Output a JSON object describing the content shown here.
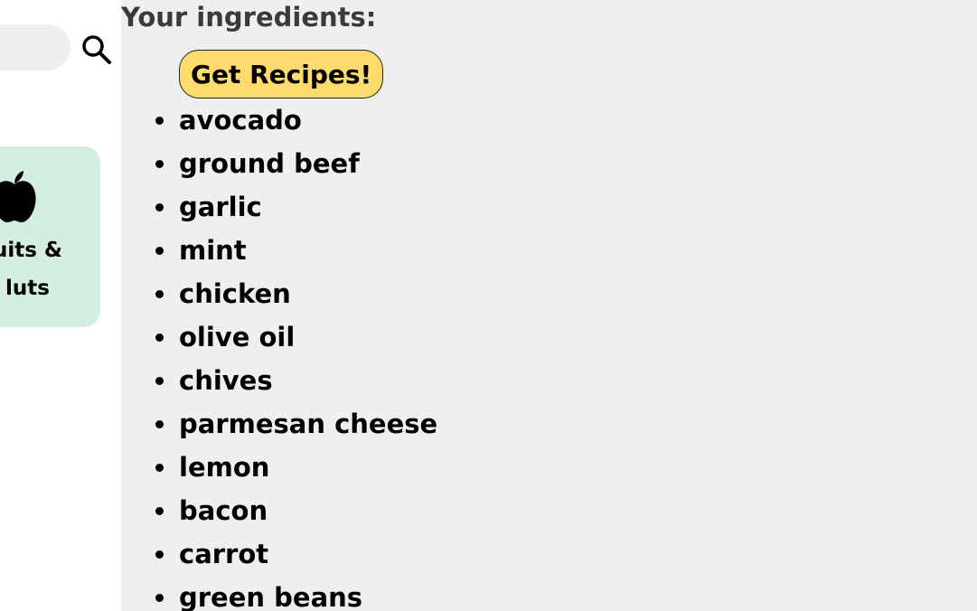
{
  "search": {
    "placeholder": "",
    "icon": "search-icon"
  },
  "category": {
    "icon": "apple-icon",
    "label_line1": "uits &",
    "label_line2": "luts"
  },
  "main": {
    "title": "Your ingredients:",
    "button_label": "Get Recipes!",
    "ingredients": [
      "avocado",
      "ground beef",
      "garlic",
      "mint",
      "chicken",
      "olive oil",
      "chives",
      "parmesan cheese",
      "lemon",
      "bacon",
      "carrot",
      "green beans"
    ]
  },
  "colors": {
    "main_background": "#efefef",
    "category_card": "#d4eedf",
    "button_background": "#ffdb6d",
    "search_background": "#eeeeee"
  }
}
